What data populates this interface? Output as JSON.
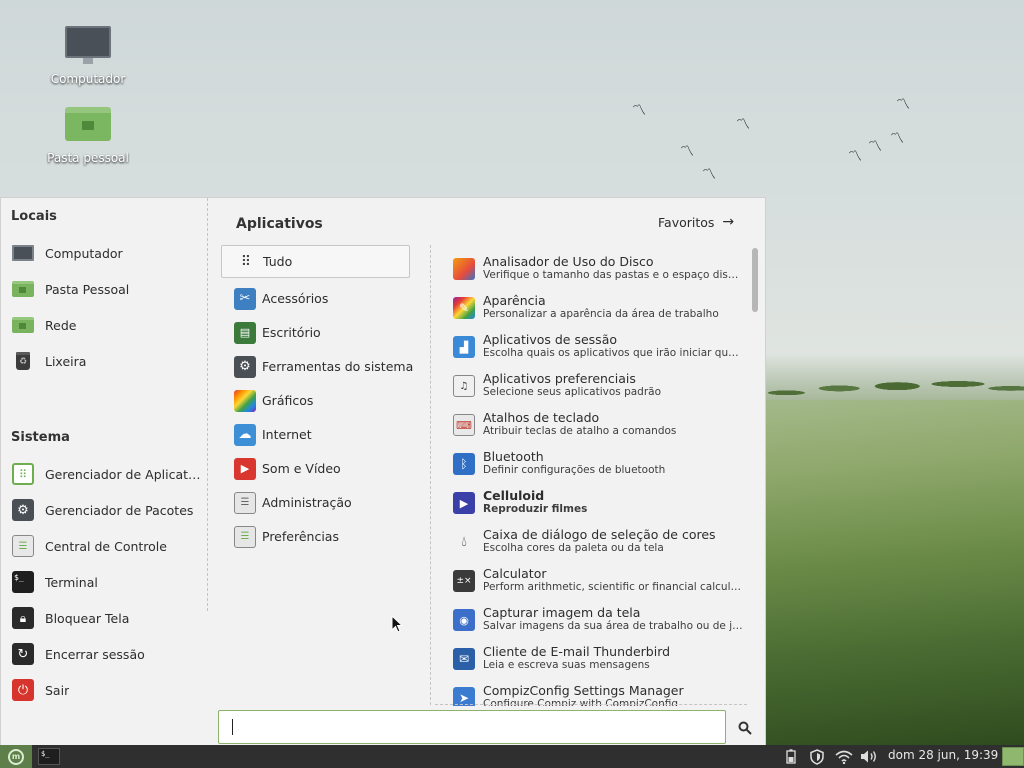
{
  "desktop": {
    "icons": [
      {
        "label": "Computador"
      },
      {
        "label": "Pasta pessoal"
      }
    ]
  },
  "menu": {
    "places": {
      "title": "Locais",
      "items": [
        {
          "label": "Computador",
          "icon": "computer-icon"
        },
        {
          "label": "Pasta Pessoal",
          "icon": "home-folder-icon"
        },
        {
          "label": "Rede",
          "icon": "network-folder-icon"
        },
        {
          "label": "Lixeira",
          "icon": "trash-icon"
        }
      ]
    },
    "system": {
      "title": "Sistema",
      "items": [
        {
          "label": "Gerenciador de Aplicativos",
          "icon": "software-manager-icon"
        },
        {
          "label": "Gerenciador de Pacotes",
          "icon": "package-manager-icon"
        },
        {
          "label": "Central de Controle",
          "icon": "control-center-icon"
        },
        {
          "label": "Terminal",
          "icon": "terminal-icon"
        },
        {
          "label": "Bloquear Tela",
          "icon": "lock-icon"
        },
        {
          "label": "Encerrar sessão",
          "icon": "logout-icon"
        },
        {
          "label": "Sair",
          "icon": "power-icon"
        }
      ]
    },
    "applications_title": "Aplicativos",
    "favorites_label": "Favoritos",
    "categories": [
      {
        "label": "Tudo",
        "icon": "grid-icon",
        "active": true
      },
      {
        "label": "Acessórios",
        "icon": "scissors-icon"
      },
      {
        "label": "Escritório",
        "icon": "office-icon"
      },
      {
        "label": "Ferramentas do sistema",
        "icon": "gear-icon"
      },
      {
        "label": "Gráficos",
        "icon": "graphics-icon"
      },
      {
        "label": "Internet",
        "icon": "cloud-icon"
      },
      {
        "label": "Som e Vídeo",
        "icon": "play-icon"
      },
      {
        "label": "Administração",
        "icon": "admin-icon"
      },
      {
        "label": "Preferências",
        "icon": "preferences-icon"
      }
    ],
    "apps": [
      {
        "name": "Analisador de Uso do Disco",
        "desc": "Verifique o tamanho das pastas e o espaço disponível em disco",
        "icon": "disk-usage-icon"
      },
      {
        "name": "Aparência",
        "desc": "Personalizar a aparência da área de trabalho",
        "icon": "appearance-icon"
      },
      {
        "name": "Aplicativos de sessão",
        "desc": "Escolha quais os aplicativos que irão iniciar quando você iniciar a sessão",
        "icon": "session-apps-icon"
      },
      {
        "name": "Aplicativos preferenciais",
        "desc": "Selecione seus aplicativos padrão",
        "icon": "preferred-apps-icon"
      },
      {
        "name": "Atalhos de teclado",
        "desc": "Atribuir teclas de atalho a comandos",
        "icon": "keyboard-icon"
      },
      {
        "name": "Bluetooth",
        "desc": "Definir configurações de bluetooth",
        "icon": "bluetooth-icon"
      },
      {
        "name": "Celluloid",
        "desc": "Reproduzir filmes",
        "icon": "celluloid-icon",
        "bold": true
      },
      {
        "name": "Caixa de diálogo de seleção de cores",
        "desc": "Escolha cores da paleta ou da tela",
        "icon": "color-picker-icon"
      },
      {
        "name": "Calculator",
        "desc": "Perform arithmetic, scientific or financial calculations",
        "icon": "calculator-icon"
      },
      {
        "name": "Capturar imagem da tela",
        "desc": "Salvar imagens da sua área de trabalho ou de janelas individuais",
        "icon": "screenshot-icon"
      },
      {
        "name": "Cliente de E-mail Thunderbird",
        "desc": "Leia e escreva suas mensagens",
        "icon": "mail-icon"
      },
      {
        "name": "CompizConfig Settings Manager",
        "desc": "Configure Compiz with CompizConfig",
        "icon": "compiz-icon"
      }
    ],
    "search": {
      "value": "",
      "placeholder": ""
    }
  },
  "taskbar": {
    "clock": "dom 28 jun, 19:39",
    "tray_icons": [
      "battery-icon",
      "shield-icon",
      "wifi-icon",
      "volume-icon"
    ]
  },
  "colors": {
    "menu_bg": "#f2f2f2",
    "accent": "#8cb369",
    "taskbar_bg": "#2f2f2f"
  }
}
